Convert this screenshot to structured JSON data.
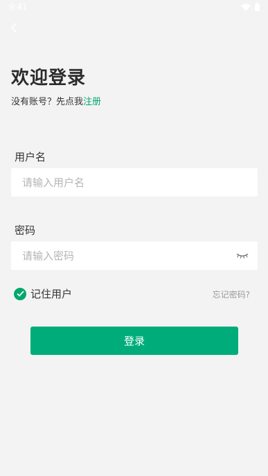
{
  "status_bar": {
    "time": "9:41"
  },
  "header": {
    "title": "欢迎登录",
    "subtitle_prefix": "没有账号？先点我",
    "register_link": "注册"
  },
  "form": {
    "username_label": "用户名",
    "username_placeholder": "请输入用户名",
    "username_value": "",
    "password_label": "密码",
    "password_placeholder": "请输入密码",
    "password_value": "",
    "remember_label": "记住用户",
    "remember_checked": true,
    "forgot_link": "忘记密码?",
    "submit_label": "登录"
  },
  "icons": {
    "back": "chevron-left-icon",
    "eye": "eye-closed-icon",
    "check": "check-icon"
  },
  "colors": {
    "accent": "#00ad7a",
    "background": "#f3f3f3"
  }
}
